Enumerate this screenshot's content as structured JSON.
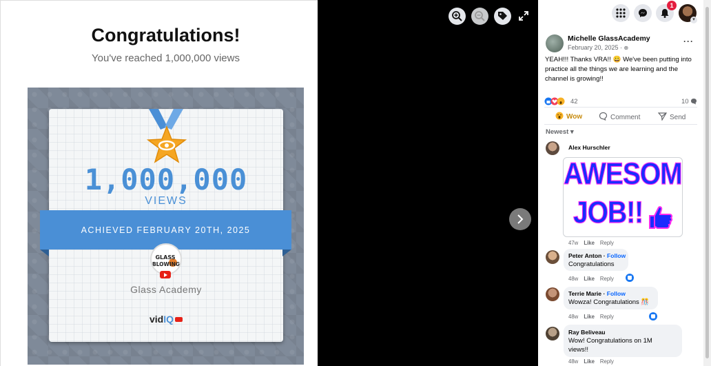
{
  "photo": {
    "title": "Congratulations!",
    "subtitle": "You've reached 1,000,000 views",
    "big_number": "1,000,000",
    "views_label": "VIEWS",
    "achieved": "ACHIEVED FEBRUARY 20TH, 2025",
    "logo_text_1": "GLASS",
    "logo_text_2": "BLOWING",
    "channel": "Glass Academy",
    "brand_vid": "vid",
    "brand_iq": "IQ"
  },
  "viewer": {
    "icons": [
      "zoom-in-icon",
      "zoom-out-icon",
      "tag-icon",
      "expand-icon",
      "chevron-right-icon"
    ]
  },
  "top_bar": {
    "notification_count": "1",
    "icons": [
      "menu-grid-icon",
      "messenger-icon",
      "bell-icon"
    ]
  },
  "post": {
    "author": "Michelle GlassAcademy",
    "date": "February 20, 2025 · ",
    "text": "YEAH!!! Thanks VRA!! 😀 We've been putting into practice all the things we are learning and the channel is growing!!",
    "reaction_count": "42",
    "comment_count": "10",
    "actions": {
      "wow": "Wow",
      "comment": "Comment",
      "send": "Send"
    }
  },
  "comments": {
    "sort_label": "Newest",
    "items": [
      {
        "name": "Alex Hurschler",
        "gif_line1": "AWESOME",
        "gif_line2": "JOB!!",
        "time": "47w",
        "like": "Like",
        "reply": "Reply"
      },
      {
        "name": "Peter Anton",
        "follow": "Follow",
        "text": "Congratulations",
        "time": "48w",
        "like": "Like",
        "reply": "Reply"
      },
      {
        "name": "Terrie Marie",
        "follow": "Follow",
        "text": "Wowza! Congratulations 🎊",
        "time": "48w",
        "like": "Like",
        "reply": "Reply"
      },
      {
        "name": "Ray Beliveau",
        "text_1": "Wow! Congratulations on 1M",
        "text_2": "views!!",
        "time": "48w",
        "like": "Like",
        "reply": "Reply"
      }
    ]
  },
  "colors": {
    "accent_blue": "#4a90d6",
    "fb_blue": "#0866ff",
    "notif_red": "#e41e3f",
    "wow_yellow": "#c78b0e"
  }
}
